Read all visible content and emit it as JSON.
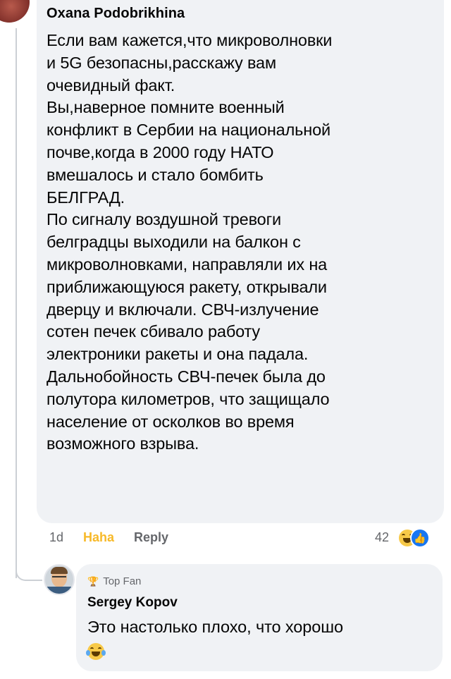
{
  "top_comment": {
    "cropped_label": "Top Fan",
    "author": "Oxana Podobrikhina",
    "text": "Если вам кажется,что микроволновки\nи 5G безопасны,расскажу вам\nочевидный факт.\nВы,наверное помните военный\nконфликт в Сербии на национальной\nпочве,когда в 2000 году НАТО\nвмешалось и стало бомбить\nБЕЛГРАД.\nПо сигналу воздушной тревоги\nбелградцы выходили на балкон с\nмикроволновками, направляли их на\nприближающуюся ракету, открывали\nдверцу и включали. СВЧ-излучение\nсотен печек сбивало работу\nэлектроники ракеты и она падала.\nДальнобойность СВЧ-печек была до\nполутора километров, что защищало\nнаселение от осколков во время\nвозможного взрыва.",
    "time": "1d",
    "reaction_label": "Haha",
    "reply_label": "Reply",
    "reaction_count": "42",
    "reaction_icons": [
      "haha-emoji-icon",
      "like-icon"
    ],
    "bubble_color": "#f0f2f5",
    "haha_color": "#f7b928",
    "like_color": "#1877f2"
  },
  "reply_comment": {
    "badge_icon": "trophy-icon",
    "badge": "Top Fan",
    "author": "Sergey Kopov",
    "text": "Это настолько плохо, что хорошо",
    "emoji_icon": "laughing-tears-emoji-icon"
  }
}
